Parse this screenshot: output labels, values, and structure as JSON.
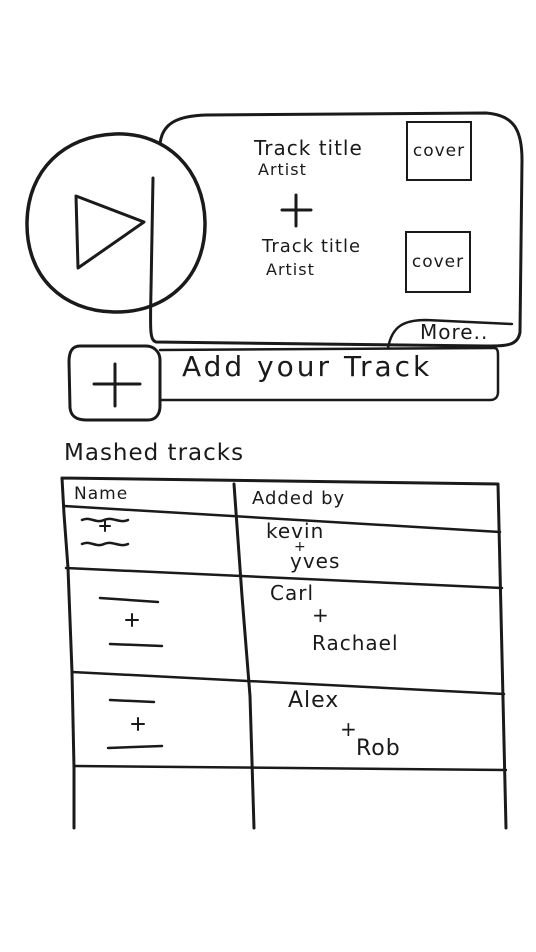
{
  "player": {
    "play_icon": "play-icon"
  },
  "queue": {
    "items": [
      {
        "title": "Track title",
        "artist": "Artist",
        "cover_label": "cover"
      },
      {
        "title": "Track title",
        "artist": "Artist",
        "cover_label": "cover"
      }
    ],
    "combine_icon": "plus-icon",
    "more_label": "More.."
  },
  "add_track": {
    "icon": "plus-icon",
    "label": "Add your Track"
  },
  "mashed": {
    "title": "Mashed tracks",
    "columns": {
      "name": "Name",
      "added_by": "Added by"
    },
    "rows": [
      {
        "user_a": "kevin",
        "joiner": "+",
        "user_b": "yves"
      },
      {
        "user_a": "Carl",
        "joiner": "+",
        "user_b": "Rachael"
      },
      {
        "user_a": "Alex",
        "joiner": "+",
        "user_b": "Rob"
      }
    ]
  }
}
